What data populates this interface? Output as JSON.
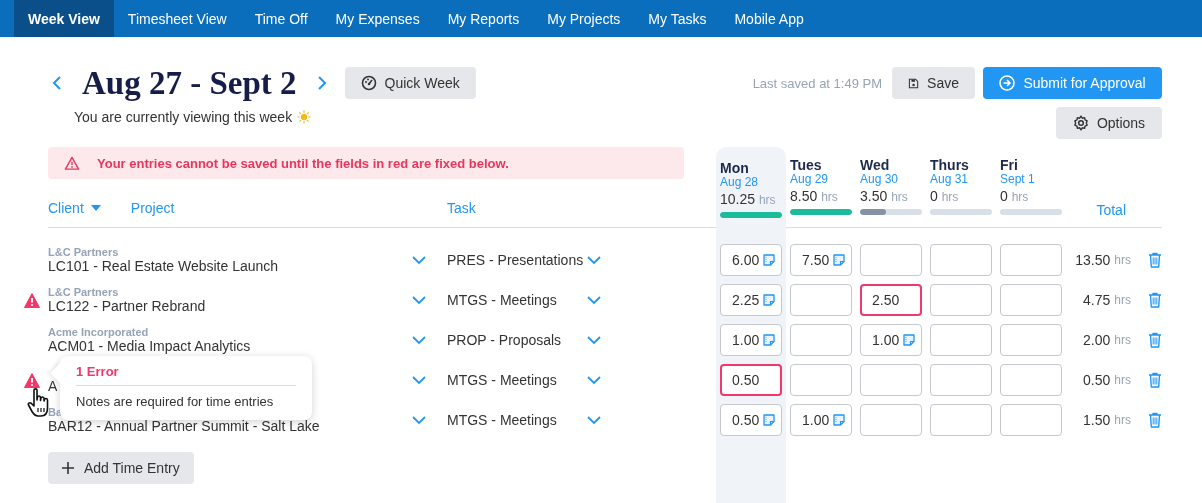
{
  "nav_tabs": [
    {
      "label": "Week View",
      "selected": true
    },
    {
      "label": "Timesheet View",
      "selected": false
    },
    {
      "label": "Time Off",
      "selected": false
    },
    {
      "label": "My Expenses",
      "selected": false
    },
    {
      "label": "My Reports",
      "selected": false
    },
    {
      "label": "My Projects",
      "selected": false
    },
    {
      "label": "My Tasks",
      "selected": false
    },
    {
      "label": "Mobile App",
      "selected": false
    }
  ],
  "week": {
    "title": "Aug 27 - Sept 2",
    "subtitle": "You are currently viewing this week",
    "quick_week": "Quick Week"
  },
  "last_saved": "Last saved at 1:49 PM",
  "actions": {
    "save": "Save",
    "submit": "Submit for Approval",
    "options": "Options"
  },
  "error_banner": "Your entries cannot be saved until the fields in red are fixed below.",
  "columns": {
    "client": "Client",
    "project": "Project",
    "task": "Task",
    "total": "Total"
  },
  "days": [
    {
      "name": "Mon",
      "date": "Aug 28",
      "hours": "10.25",
      "unit": "hrs",
      "level": 1,
      "color": "#1bbc9b",
      "selected": true
    },
    {
      "name": "Tues",
      "date": "Aug 29",
      "hours": "8.50",
      "unit": "hrs",
      "level": 1,
      "color": "#1bbc9b",
      "selected": false
    },
    {
      "name": "Wed",
      "date": "Aug 30",
      "hours": "3.50",
      "unit": "hrs",
      "level": 0.42,
      "color": "#8592a6",
      "selected": false
    },
    {
      "name": "Thurs",
      "date": "Aug 31",
      "hours": "0",
      "unit": "hrs",
      "selected": false
    },
    {
      "name": "Fri",
      "date": "Sept 1",
      "hours": "0",
      "unit": "hrs",
      "selected": false
    }
  ],
  "rows": [
    {
      "client": "L&C Partners",
      "project": "LC101 - Real Estate Website Launch",
      "task": "PRES - Presentations",
      "error": false,
      "total": "13.50",
      "unit": "hrs",
      "cells": [
        {
          "value": "6.00",
          "note": true,
          "error": false
        },
        {
          "value": "7.50",
          "note": true,
          "error": false
        },
        {
          "note": false,
          "error": false
        },
        {
          "note": false,
          "error": false
        },
        {
          "note": false,
          "error": false
        }
      ]
    },
    {
      "client": "L&C Partners",
      "project": "LC122 - Partner Rebrand",
      "task": "MTGS - Meetings",
      "error": true,
      "total": "4.75",
      "unit": "hrs",
      "cells": [
        {
          "value": "2.25",
          "note": true,
          "error": false
        },
        {
          "note": false,
          "error": false
        },
        {
          "value": "2.50",
          "note": false,
          "error": true
        },
        {
          "note": false,
          "error": false
        },
        {
          "note": false,
          "error": false
        }
      ]
    },
    {
      "client": "Acme Incorporated",
      "project": "ACM01 - Media Impact Analytics",
      "task": "PROP - Proposals",
      "error": false,
      "total": "2.00",
      "unit": "hrs",
      "cells": [
        {
          "value": "1.00",
          "note": true,
          "error": false
        },
        {
          "note": false,
          "error": false
        },
        {
          "value": "1.00",
          "note": true,
          "error": false
        },
        {
          "note": false,
          "error": false
        },
        {
          "note": false,
          "error": false
        }
      ]
    },
    {
      "project": "A",
      "task": "MTGS - Meetings",
      "error": true,
      "total": "0.50",
      "unit": "hrs",
      "tooltip": {
        "title": "1 Error",
        "message": "Notes are required for time entries"
      },
      "cells": [
        {
          "value": "0.50",
          "note": false,
          "error": true
        },
        {
          "note": false,
          "error": false
        },
        {
          "note": false,
          "error": false
        },
        {
          "note": false,
          "error": false
        },
        {
          "note": false,
          "error": false
        }
      ]
    },
    {
      "client": "Ba",
      "project": "BAR12 - Annual Partner Summit - Salt Lake",
      "task": "MTGS - Meetings",
      "error": false,
      "total": "1.50",
      "unit": "hrs",
      "cells": [
        {
          "value": "0.50",
          "note": true,
          "error": false
        },
        {
          "value": "1.00",
          "note": true,
          "error": false
        },
        {
          "note": false,
          "error": false
        },
        {
          "note": false,
          "error": false
        },
        {
          "note": false,
          "error": false
        }
      ]
    }
  ],
  "add_button": "Add Time Entry"
}
